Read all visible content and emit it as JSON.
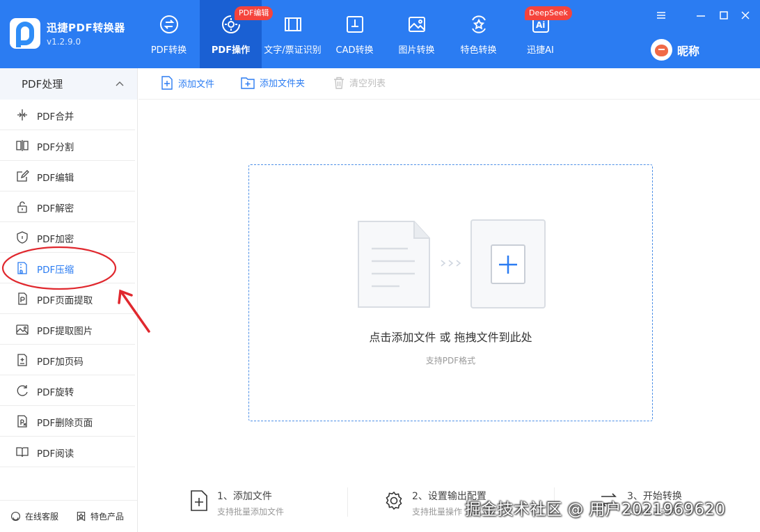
{
  "app": {
    "name": "迅捷PDF转换器",
    "version": "v1.2.9.0"
  },
  "nav": {
    "tabs": [
      {
        "label": "PDF转换",
        "icon": "convert-icon",
        "active": false
      },
      {
        "label": "PDF操作",
        "icon": "gear-icon",
        "active": true,
        "badge": "PDF编辑"
      },
      {
        "label": "文字/票证识别",
        "icon": "scan-icon",
        "active": false
      },
      {
        "label": "CAD转换",
        "icon": "cad-icon",
        "active": false
      },
      {
        "label": "图片转换",
        "icon": "image-icon",
        "active": false
      },
      {
        "label": "特色转换",
        "icon": "star-icon",
        "active": false
      },
      {
        "label": "迅捷AI",
        "icon": "ai-icon",
        "active": false,
        "badge": "DeepSeek"
      }
    ]
  },
  "user": {
    "name": "昵称"
  },
  "sidebar": {
    "section_title": "PDF处理",
    "items": [
      {
        "label": "PDF合并",
        "icon": "merge-icon"
      },
      {
        "label": "PDF分割",
        "icon": "split-icon"
      },
      {
        "label": "PDF编辑",
        "icon": "edit-icon"
      },
      {
        "label": "PDF解密",
        "icon": "unlock-icon"
      },
      {
        "label": "PDF加密",
        "icon": "shield-icon"
      },
      {
        "label": "PDF压缩",
        "icon": "compress-icon",
        "highlighted": true
      },
      {
        "label": "PDF页面提取",
        "icon": "page-extract-icon"
      },
      {
        "label": "PDF提取图片",
        "icon": "image-extract-icon"
      },
      {
        "label": "PDF加页码",
        "icon": "page-number-icon"
      },
      {
        "label": "PDF旋转",
        "icon": "rotate-icon"
      },
      {
        "label": "PDF删除页面",
        "icon": "delete-page-icon"
      },
      {
        "label": "PDF阅读",
        "icon": "book-icon"
      }
    ],
    "footer": {
      "support": "在线客服",
      "products": "特色产品"
    }
  },
  "toolbar": {
    "add_file": "添加文件",
    "add_folder": "添加文件夹",
    "clear_list": "清空列表"
  },
  "dropzone": {
    "title": "点击添加文件 或 拖拽文件到此处",
    "subtitle": "支持PDF格式"
  },
  "steps": [
    {
      "title": "1、添加文件",
      "subtitle": "支持批量添加文件"
    },
    {
      "title": "2、设置输出配置",
      "subtitle": "支持批量操作"
    },
    {
      "title": "3、开始转换",
      "subtitle": "支持批量转换"
    }
  ],
  "watermark": "掘金技术社区 @ 用户2021969620",
  "colors": {
    "header": "#2b7cf2",
    "active_tab": "#1a60d3",
    "badge": "#f5443c",
    "highlight": "#2b7cf2",
    "annotation": "#e0282e"
  }
}
